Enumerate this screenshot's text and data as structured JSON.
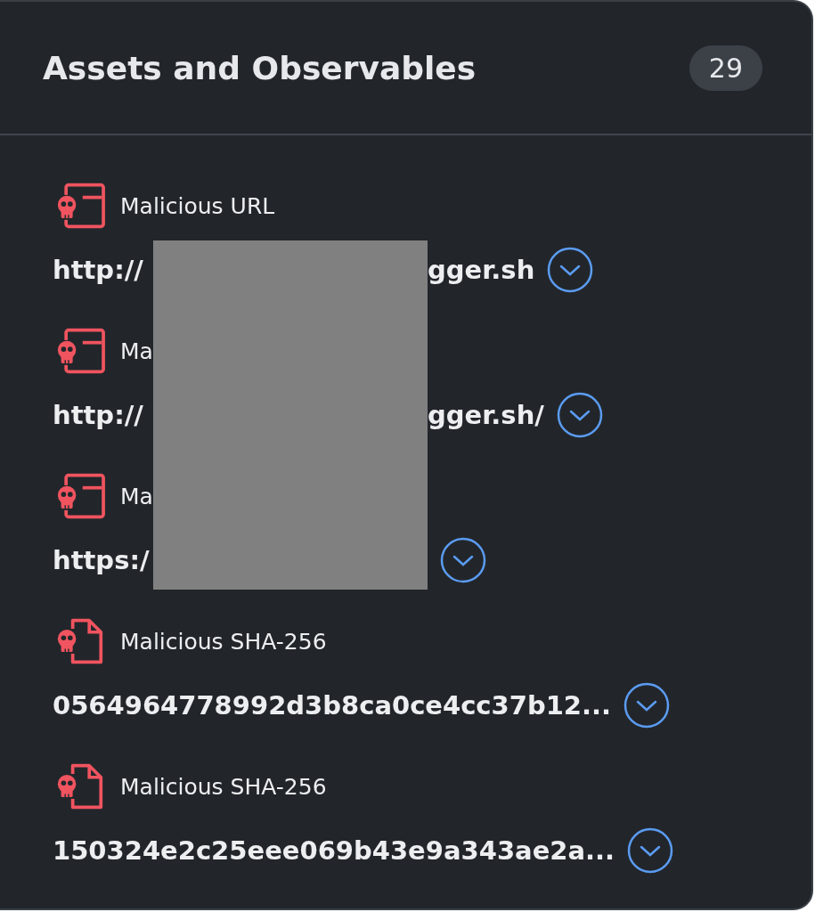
{
  "panel": {
    "title": "Assets and Observables",
    "count": "29"
  },
  "redaction_box": true,
  "items": [
    {
      "kind": "url",
      "label": "Malicious URL",
      "value_start": "http://",
      "redacted": true,
      "value_end": "gger.sh"
    },
    {
      "kind": "url",
      "label": "Ma",
      "value_start": "http://",
      "redacted": true,
      "value_end": "gger.sh/"
    },
    {
      "kind": "url",
      "label": "Ma",
      "value_start": "https:/",
      "redacted": true
    },
    {
      "kind": "file",
      "label": "Malicious SHA-256",
      "value_start": "0564964778992d3b8ca0ce4cc37b12...",
      "redacted": false
    },
    {
      "kind": "file",
      "label": "Malicious SHA-256",
      "value_start": "150324e2c25eee069b43e9a343ae2a...",
      "redacted": false
    }
  ]
}
